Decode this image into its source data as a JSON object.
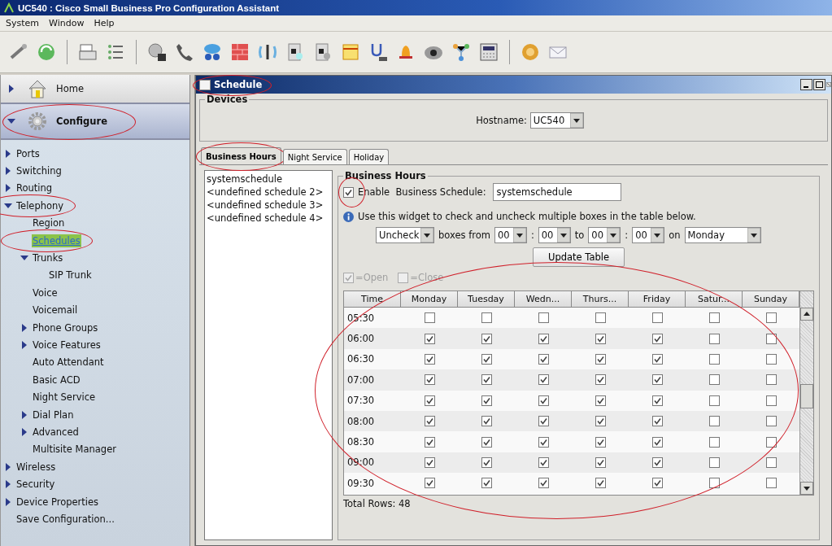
{
  "window": {
    "title": "UC540 : Cisco Small Business Pro Configuration Assistant"
  },
  "menu": [
    "System",
    "Window",
    "Help"
  ],
  "sidebar": {
    "headers": [
      {
        "label": "Home",
        "kind": "home",
        "expanded": false,
        "selected": false,
        "circled": false
      },
      {
        "label": "Configure",
        "kind": "configure",
        "expanded": true,
        "selected": true,
        "circled": true
      }
    ],
    "tree": [
      {
        "label": "Ports",
        "expanded": false,
        "selected": false,
        "circled": false
      },
      {
        "label": "Switching",
        "expanded": false,
        "selected": false,
        "circled": false
      },
      {
        "label": "Routing",
        "expanded": false,
        "selected": false,
        "circled": false
      },
      {
        "label": "Telephony",
        "expanded": true,
        "selected": false,
        "circled": true,
        "children": [
          {
            "label": "Region",
            "selected": false,
            "circled": false
          },
          {
            "label": "Schedules",
            "selected": true,
            "circled": true
          },
          {
            "label": "Trunks",
            "expanded": true,
            "selected": false,
            "circled": false,
            "children": [
              {
                "label": "SIP Trunk",
                "selected": false,
                "circled": false
              }
            ]
          },
          {
            "label": "Voice",
            "selected": false,
            "circled": false
          },
          {
            "label": "Voicemail",
            "selected": false,
            "circled": false
          },
          {
            "label": "Phone Groups",
            "expanded": false,
            "selected": false,
            "circled": false
          },
          {
            "label": "Voice Features",
            "expanded": false,
            "selected": false,
            "circled": false
          },
          {
            "label": "Auto Attendant",
            "selected": false,
            "circled": false
          },
          {
            "label": "Basic ACD",
            "selected": false,
            "circled": false
          },
          {
            "label": "Night Service",
            "selected": false,
            "circled": false
          },
          {
            "label": "Dial Plan",
            "expanded": false,
            "selected": false,
            "circled": false
          },
          {
            "label": "Advanced",
            "expanded": false,
            "selected": false,
            "circled": false
          },
          {
            "label": "Multisite Manager",
            "selected": false,
            "circled": false
          }
        ]
      },
      {
        "label": "Wireless",
        "expanded": false,
        "selected": false,
        "circled": false
      },
      {
        "label": "Security",
        "expanded": false,
        "selected": false,
        "circled": false
      },
      {
        "label": "Device Properties",
        "expanded": false,
        "selected": false,
        "circled": false
      },
      {
        "label": "Save Configuration...",
        "selected": false,
        "circled": false
      }
    ]
  },
  "schedule_window": {
    "title": "Schedule",
    "circled": true,
    "devices": {
      "legend": "Devices",
      "hostname_label": "Hostname:",
      "hostname": "UC540"
    },
    "tabs": [
      {
        "label": "Business Hours",
        "selected": true,
        "circled": true
      },
      {
        "label": "Night Service",
        "selected": false,
        "circled": false
      },
      {
        "label": "Holiday",
        "selected": false,
        "circled": false
      }
    ],
    "schedules": [
      "systemschedule",
      "<undefined schedule 2>",
      "<undefined schedule 3>",
      "<undefined schedule 4>"
    ],
    "business_hours": {
      "legend": "Business Hours",
      "enable": {
        "label": "Enable  Business Schedule:",
        "checked": true,
        "circled": true
      },
      "schedule_name": "systemschedule",
      "info": "Use this widget to check and uncheck multiple boxes in the table below.",
      "bulk": {
        "action": "Uncheck",
        "from_label": "boxes from",
        "from_hour": "00",
        "separator_1": ":",
        "from_minute": "00",
        "to_label": "to",
        "to_hour": "00",
        "separator_2": ":",
        "to_minute": "00",
        "on_label": "on",
        "day": "Monday",
        "button": "Update Table"
      },
      "key": [
        {
          "label": "=Open",
          "checked": true
        },
        {
          "label": "=Close",
          "checked": false
        }
      ],
      "table": {
        "circled": true,
        "columns": [
          "Time",
          "Monday",
          "Tuesday",
          "Wedn...",
          "Thurs...",
          "Friday",
          "Satur...",
          "Sunday"
        ],
        "rows": [
          {
            "time": "05:30",
            "days": [
              false,
              false,
              false,
              false,
              false,
              false,
              false
            ]
          },
          {
            "time": "06:00",
            "days": [
              true,
              true,
              true,
              true,
              true,
              false,
              false
            ]
          },
          {
            "time": "06:30",
            "days": [
              true,
              true,
              true,
              true,
              true,
              false,
              false
            ]
          },
          {
            "time": "07:00",
            "days": [
              true,
              true,
              true,
              true,
              true,
              false,
              false
            ]
          },
          {
            "time": "07:30",
            "days": [
              true,
              true,
              true,
              true,
              true,
              false,
              false
            ]
          },
          {
            "time": "08:00",
            "days": [
              true,
              true,
              true,
              true,
              true,
              false,
              false
            ]
          },
          {
            "time": "08:30",
            "days": [
              true,
              true,
              true,
              true,
              true,
              false,
              false
            ]
          },
          {
            "time": "09:00",
            "days": [
              true,
              true,
              true,
              true,
              true,
              false,
              false
            ]
          },
          {
            "time": "09:30",
            "days": [
              true,
              true,
              true,
              true,
              true,
              false,
              false
            ]
          }
        ],
        "footer": "Total Rows: 48"
      }
    }
  }
}
